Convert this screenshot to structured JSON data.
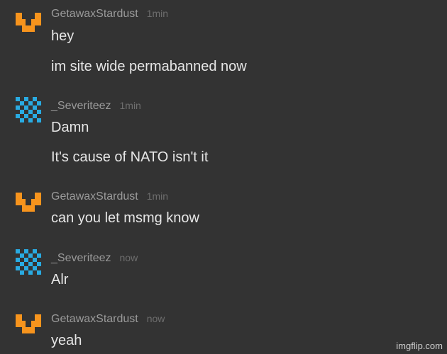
{
  "messages": [
    {
      "user": "GetawaxStardust",
      "time": "1min",
      "avatar": "orange-identicon-icon",
      "lines": [
        "hey",
        "im site wide permabanned now"
      ]
    },
    {
      "user": "_Severiteez",
      "time": "1min",
      "avatar": "blue-identicon-icon",
      "lines": [
        "Damn",
        "It's cause of NATO isn't it"
      ]
    },
    {
      "user": "GetawaxStardust",
      "time": "1min",
      "avatar": "orange-identicon-icon",
      "lines": [
        "can you let msmg know"
      ]
    },
    {
      "user": "_Severiteez",
      "time": "now",
      "avatar": "blue-identicon-icon",
      "lines": [
        "Alr"
      ]
    },
    {
      "user": "GetawaxStardust",
      "time": "now",
      "avatar": "orange-identicon-icon",
      "lines": [
        "yeah"
      ]
    }
  ],
  "watermark": "imgflip.com",
  "colors": {
    "background": "#333333",
    "orange_avatar": "#f7941d",
    "blue_avatar": "#29abe2"
  }
}
